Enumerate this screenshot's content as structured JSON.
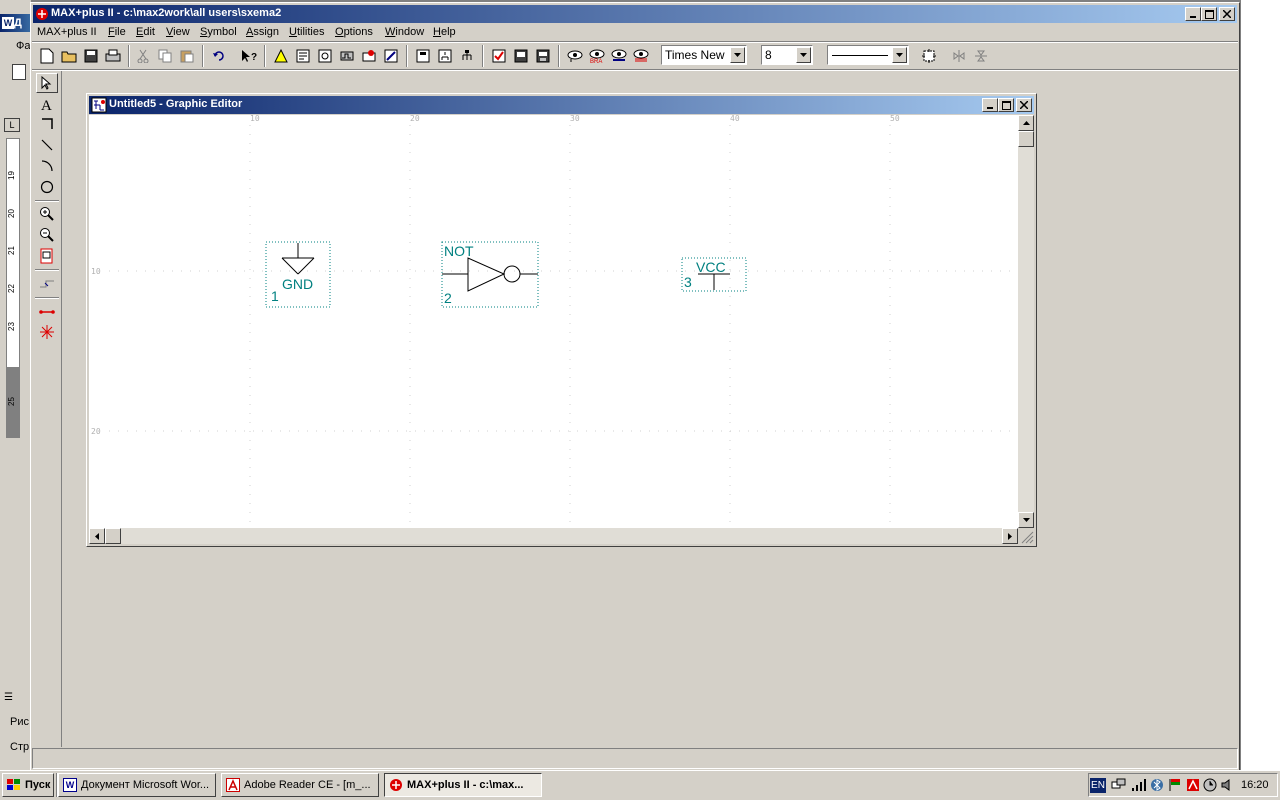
{
  "app": {
    "title": "MAX+plus II - c:\\max2work\\all users\\sxema2",
    "menu": [
      {
        "label": "MAX+plus II",
        "u": ""
      },
      {
        "label": "File",
        "u": "F"
      },
      {
        "label": "Edit",
        "u": "E"
      },
      {
        "label": "View",
        "u": "V"
      },
      {
        "label": "Symbol",
        "u": "S"
      },
      {
        "label": "Assign",
        "u": "A"
      },
      {
        "label": "Utilities",
        "u": "U"
      },
      {
        "label": "Options",
        "u": "O"
      },
      {
        "label": "Window",
        "u": "W"
      },
      {
        "label": "Help",
        "u": "H"
      }
    ],
    "font_combo": "Times New",
    "size_combo": "8"
  },
  "editor": {
    "title": "Untitled5 - Graphic Editor",
    "ruler_top": [
      "10",
      "20",
      "30",
      "40",
      "50"
    ],
    "ruler_left": [
      "10",
      "20"
    ],
    "symbols": {
      "gnd": {
        "name": "GND",
        "index": "1"
      },
      "not": {
        "name": "NOT",
        "index": "2"
      },
      "vcc": {
        "name": "VCC",
        "index": "3"
      }
    }
  },
  "background_word": {
    "ruler_nums": [
      "19",
      "20",
      "21",
      "22",
      "23",
      "25"
    ],
    "side_labels": [
      "Д",
      "Фа",
      "Рис",
      "Стр"
    ]
  },
  "taskbar": {
    "start": "Пуск",
    "items": [
      {
        "label": "Документ Microsoft Wor..."
      },
      {
        "label": "Adobe Reader CE - [m_..."
      },
      {
        "label": "MAX+plus II - c:\\max..."
      }
    ],
    "lang": "EN",
    "clock": "16:20"
  },
  "colors": {
    "titlebar_start": "#0a246a",
    "titlebar_end": "#a6caf0",
    "schematic": "#008080",
    "desktop_gray": "#808080"
  }
}
